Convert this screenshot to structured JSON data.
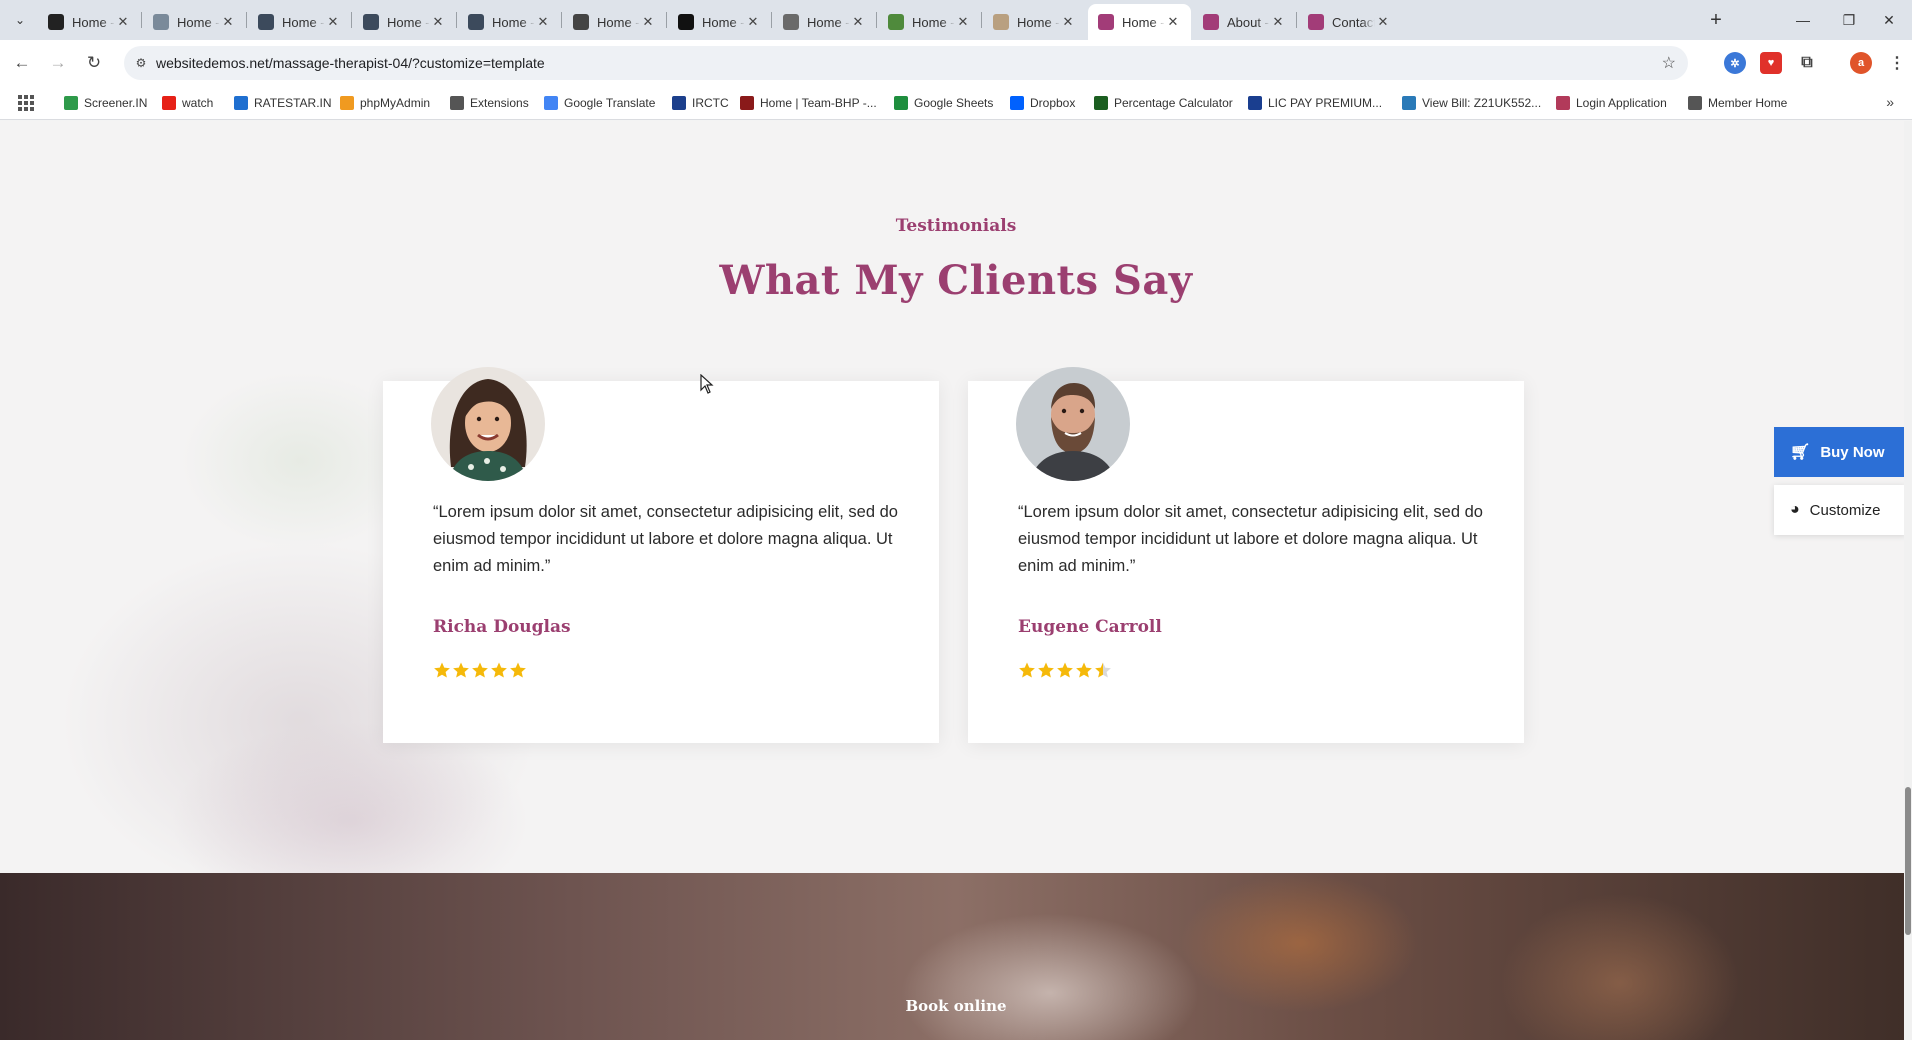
{
  "tabs": [
    {
      "title": "Home - Br",
      "favicon": "brand-logo",
      "favicon_color": "#222222",
      "active": false
    },
    {
      "title": "Home - Lo",
      "favicon": "lotus-logo",
      "favicon_color": "#7a8a9a",
      "active": false
    },
    {
      "title": "Home - Be",
      "favicon": "wordpress-logo",
      "favicon_color": "#3c4a5c",
      "active": false
    },
    {
      "title": "Home - Ka",
      "favicon": "wordpress-logo",
      "favicon_color": "#3c4a5c",
      "active": false
    },
    {
      "title": "Home - In",
      "favicon": "wordpress-logo",
      "favicon_color": "#3c4a5c",
      "active": false
    },
    {
      "title": "Home - Je",
      "favicon": "ring-logo",
      "favicon_color": "#444444",
      "active": false
    },
    {
      "title": "Home - Fa",
      "favicon": "kf-logo",
      "favicon_color": "#111111",
      "active": false
    },
    {
      "title": "Home - Fa",
      "favicon": "leaf-logo",
      "favicon_color": "#6a6a6a",
      "active": false
    },
    {
      "title": "Home - Be",
      "favicon": "plant-logo",
      "favicon_color": "#4f8a3c",
      "active": false
    },
    {
      "title": "Home - Ha",
      "favicon": "circle-logo",
      "favicon_color": "#b9a080",
      "active": false
    },
    {
      "title": "Home - M",
      "favicon": "spa-logo",
      "favicon_color": "#a23c78",
      "active": true
    },
    {
      "title": "About - M",
      "favicon": "spa-logo",
      "favicon_color": "#a23c78",
      "active": false
    },
    {
      "title": "Contact - ",
      "favicon": "spa-logo",
      "favicon_color": "#a23c78",
      "active": false
    }
  ],
  "address_bar": {
    "url": "websitedemos.net/massage-therapist-04/?customize=template"
  },
  "bookmarks": [
    {
      "label": "Screener.IN",
      "icon": "bar-chart-icon",
      "color": "#2e9a4a"
    },
    {
      "label": "watch",
      "icon": "youtube-icon",
      "color": "#e62117"
    },
    {
      "label": "RATESTAR.IN",
      "icon": "ratestar-icon",
      "color": "#1f6fd0"
    },
    {
      "label": "phpMyAdmin",
      "icon": "phpmyadmin-icon",
      "color": "#f09a20"
    },
    {
      "label": "Extensions",
      "icon": "puzzle-icon",
      "color": "#555555"
    },
    {
      "label": "Google Translate",
      "icon": "translate-icon",
      "color": "#4285f4"
    },
    {
      "label": "IRCTC",
      "icon": "irctc-icon",
      "color": "#1c3f8c"
    },
    {
      "label": "Home | Team-BHP -...",
      "icon": "teambhp-icon",
      "color": "#8a1a1a"
    },
    {
      "label": "Google Sheets",
      "icon": "sheets-icon",
      "color": "#1e8e3e"
    },
    {
      "label": "Dropbox",
      "icon": "dropbox-icon",
      "color": "#0061fe"
    },
    {
      "label": "Percentage Calculator",
      "icon": "percent-icon",
      "color": "#1b5e20"
    },
    {
      "label": "LIC PAY PREMIUM...",
      "icon": "lic-icon",
      "color": "#1a3e8f"
    },
    {
      "label": "View Bill: Z21UK552...",
      "icon": "bill-icon",
      "color": "#2a7ab8"
    },
    {
      "label": "Login Application",
      "icon": "login-icon",
      "color": "#b23a5a"
    },
    {
      "label": "Member Home",
      "icon": "globe-icon",
      "color": "#555555"
    }
  ],
  "section": {
    "eyebrow": "Testimonials",
    "heading": "What My Clients Say"
  },
  "testimonials": [
    {
      "quote": "“Lorem ipsum dolor sit amet, consectetur adipisicing elit, sed do eiusmod tempor incididunt ut labore et dolore magna aliqua. Ut enim ad minim.”",
      "name": "Richa Douglas",
      "rating": 5,
      "rating_max": 5,
      "avatar": "woman-portrait"
    },
    {
      "quote": "“Lorem ipsum dolor sit amet, consectetur adipisicing elit, sed do eiusmod tempor incididunt ut labore et dolore magna aliqua. Ut enim ad minim.”",
      "name": "Eugene Carroll",
      "rating": 4.5,
      "rating_max": 5,
      "avatar": "bearded-man-portrait"
    }
  ],
  "floating": {
    "buy_label": "Buy Now",
    "customize_label": "Customize"
  },
  "book_section": {
    "label": "Book online"
  },
  "colors": {
    "accent": "#9b3f70",
    "star": "#f5b90a",
    "buy_button": "#2c6fd6"
  }
}
